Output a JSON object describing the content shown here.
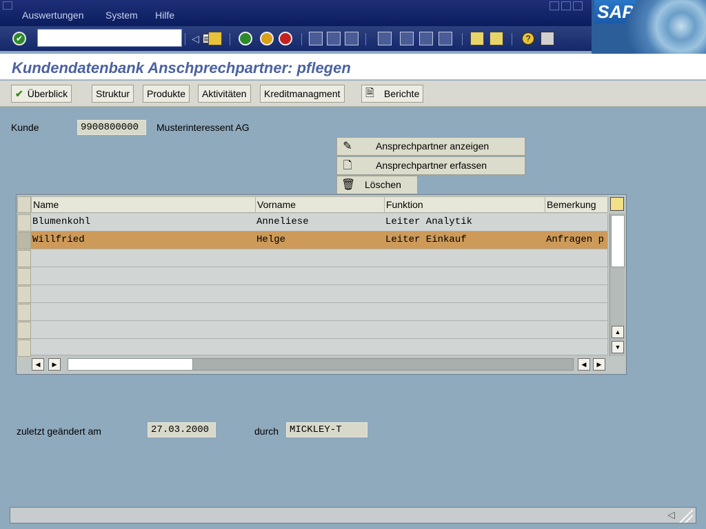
{
  "menu": {
    "items": [
      "Auswertungen",
      "System",
      "Hilfe"
    ]
  },
  "toolbar": {
    "cmd_value": ""
  },
  "title": "Kundendatenbank Anschprechpartner: pflegen",
  "app_toolbar": {
    "buttons": [
      "Überblick",
      "Struktur",
      "Produkte",
      "Aktivitäten",
      "Kreditmanagment",
      "Berichte"
    ]
  },
  "customer": {
    "label": "Kunde",
    "id": "9900800000",
    "name": "Musterinteressent AG"
  },
  "actions": {
    "show": "Ansprechpartner anzeigen",
    "create": "Ansprechpartner erfassen",
    "delete": "Löschen"
  },
  "table": {
    "columns": [
      "Name",
      "Vorname",
      "Funktion",
      "Bemerkung"
    ],
    "rows": [
      [
        "Blumenkohl",
        "Anneliese",
        "Leiter Analytik",
        ""
      ],
      [
        "Willfried",
        "Helge",
        "Leiter Einkauf",
        "Anfragen p"
      ]
    ]
  },
  "changed": {
    "label": "zuletzt geändert am",
    "date": "27.03.2000",
    "by_label": "durch",
    "user": "MICKLEY-T"
  },
  "colors": {
    "accent": "#4b62a1",
    "selected_row": "#cd9a59",
    "background": "#8fa9bd"
  },
  "icons": [
    "enter-icon",
    "save-icon",
    "back-icon",
    "exit-icon",
    "cancel-icon",
    "print-icon",
    "find-icon",
    "help-icon",
    "checkmark-icon",
    "report-icon",
    "edit-icon",
    "document-icon",
    "trash-icon",
    "table-settings-icon"
  ]
}
